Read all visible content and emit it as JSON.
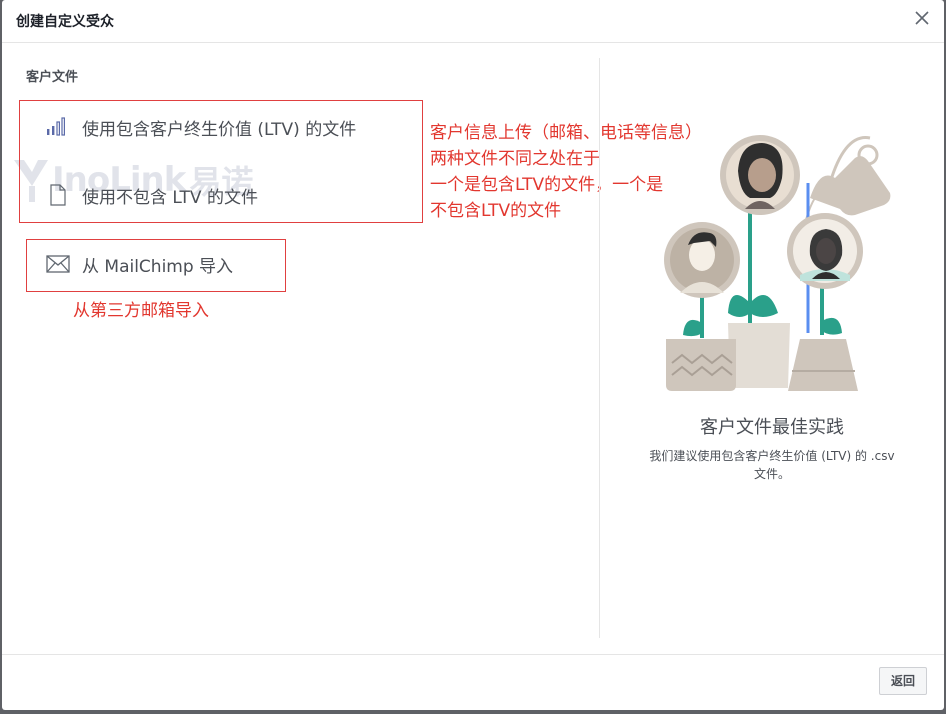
{
  "header": {
    "title": "创建自定义受众"
  },
  "left": {
    "section_label": "客户文件",
    "options": [
      {
        "label": "使用包含客户终生价值 (LTV) 的文件",
        "icon": "bar-chart-icon"
      },
      {
        "label": "使用不包含 LTV 的文件",
        "icon": "file-icon"
      },
      {
        "label": "从 MailChimp 导入",
        "icon": "envelope-icon"
      }
    ]
  },
  "watermark": {
    "text": "InoLink",
    "text2": "易诺"
  },
  "annotations": {
    "note1_lines": [
      "客户信息上传（邮箱、电话等信息）",
      "两种文件不同之处在于",
      "一个是包含LTV的文件，一个是",
      "不包含LTV的文件"
    ],
    "note2": "从第三方邮箱导入",
    "color": "#e2372f"
  },
  "right": {
    "title": "客户文件最佳实践",
    "desc_line1": "我们建议使用包含客户终生价值 (LTV) 的 .csv",
    "desc_line2": "文件。"
  },
  "footer": {
    "back_label": "返回"
  }
}
